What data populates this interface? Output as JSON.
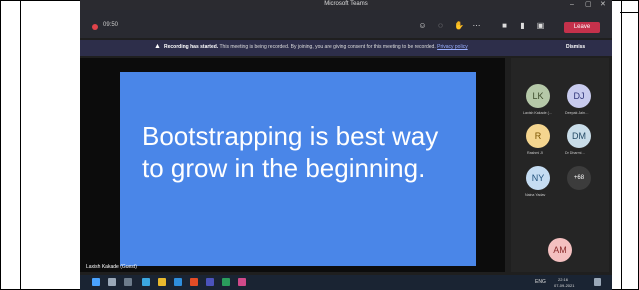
{
  "window": {
    "title": "Microsoft Teams",
    "minimize": "–",
    "maximize": "▢",
    "close": "✕"
  },
  "meeting": {
    "timer": "09:50",
    "leave_label": "Leave"
  },
  "banner": {
    "bold": "Recording has started.",
    "text": "This meeting is being recorded. By joining, you are giving consent for this meeting to be recorded.",
    "link": "Privacy policy",
    "dismiss": "Dismiss"
  },
  "slide": {
    "text": "Bootstrapping is best way to grow in the beginning."
  },
  "presenter_name": "Laxish Kakade (Guest)",
  "participants": [
    {
      "initials": "LK",
      "name": "Laxish Kakade (…",
      "bg": "#b5c8a8",
      "fg": "#3b4a2a"
    },
    {
      "initials": "DJ",
      "name": "Deepak Jain…",
      "bg": "#c8cbee",
      "fg": "#2e3478"
    },
    {
      "initials": "R",
      "name": "Rashmi JI",
      "bg": "#f4d58f",
      "fg": "#7a5400"
    },
    {
      "initials": "DM",
      "name": "Dr Dharmi…",
      "bg": "#c9dde9",
      "fg": "#254b66"
    },
    {
      "initials": "NY",
      "name": "Naina Yadav",
      "bg": "#c5dcf2",
      "fg": "#1f4f7a"
    },
    {
      "initials": "+68",
      "name": "",
      "bg": "#3c3c3c",
      "fg": "#ffffff"
    },
    {
      "initials": "AM",
      "name": "",
      "bg": "#f4c0c0",
      "fg": "#8a2a2a"
    }
  ],
  "tray": {
    "lang": "ENG",
    "time": "22:16",
    "date": "07-09-2021"
  }
}
